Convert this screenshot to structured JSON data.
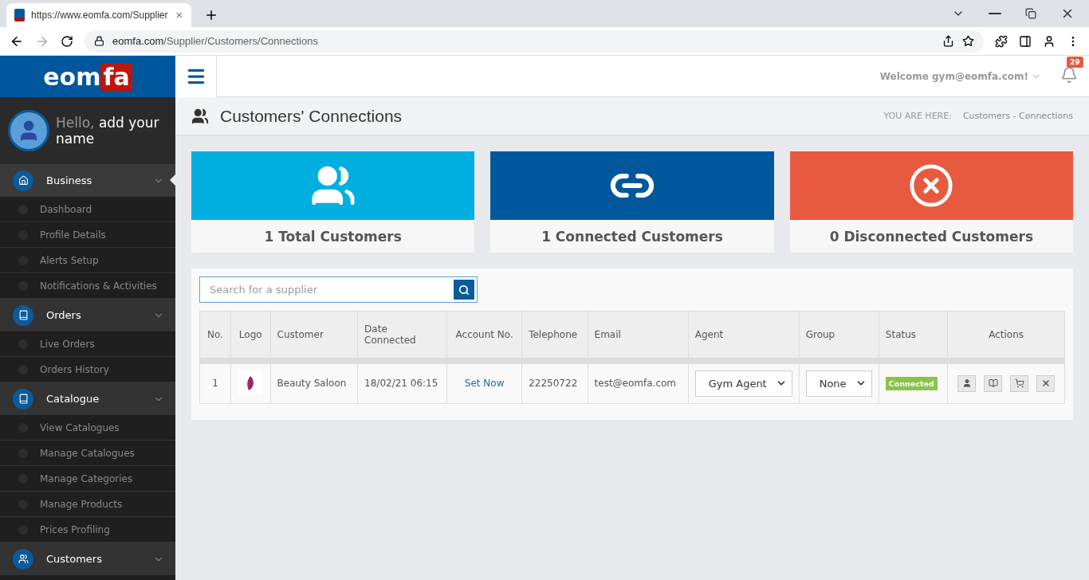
{
  "browser": {
    "tab_title": "https://www.eomfa.com/Supplier",
    "url_host": "eomfa.com",
    "url_path": "/Supplier/Customers/Connections"
  },
  "header": {
    "logo_main": "eom",
    "logo_accent": "fa",
    "welcome": "Welcome gym@eomfa.com!",
    "notification_count": "29"
  },
  "sidebar": {
    "greeting": "Hello,",
    "name": "add your name",
    "sections": [
      {
        "label": "Business",
        "selected": true,
        "items": [
          "Dashboard",
          "Profile Details",
          "Alerts Setup",
          "Notifications & Activities"
        ]
      },
      {
        "label": "Orders",
        "selected": false,
        "items": [
          "Live Orders",
          "Orders History"
        ]
      },
      {
        "label": "Catalogue",
        "selected": false,
        "items": [
          "View Catalogues",
          "Manage Catalogues",
          "Manage Categories",
          "Manage Products",
          "Prices Profiling"
        ]
      },
      {
        "label": "Customers",
        "selected": false
      }
    ]
  },
  "page": {
    "title": "Customers' Connections",
    "breadcrumb_label": "YOU ARE HERE:",
    "breadcrumb": "Customers - Connections"
  },
  "stats": [
    {
      "kind": "users",
      "label": "1 Total Customers",
      "color": "#00afe0"
    },
    {
      "kind": "link",
      "label": "1 Connected Customers",
      "color": "#00579c"
    },
    {
      "kind": "cross",
      "label": "0 Disconnected Customers",
      "color": "#e85a40"
    }
  ],
  "search": {
    "placeholder": "Search for a supplier"
  },
  "table": {
    "columns": [
      "No.",
      "Logo",
      "Customer",
      "Date Connected",
      "Account No.",
      "Telephone",
      "Email",
      "Agent",
      "Group",
      "Status",
      "Actions"
    ],
    "rows": [
      {
        "no": "1",
        "customer": "Beauty Saloon",
        "date": "18/02/21 06:15",
        "account": "Set Now",
        "telephone": "22250722",
        "email": "test@eomfa.com",
        "agent": "Gym Agent",
        "group": "None",
        "status": "Connected"
      }
    ]
  }
}
